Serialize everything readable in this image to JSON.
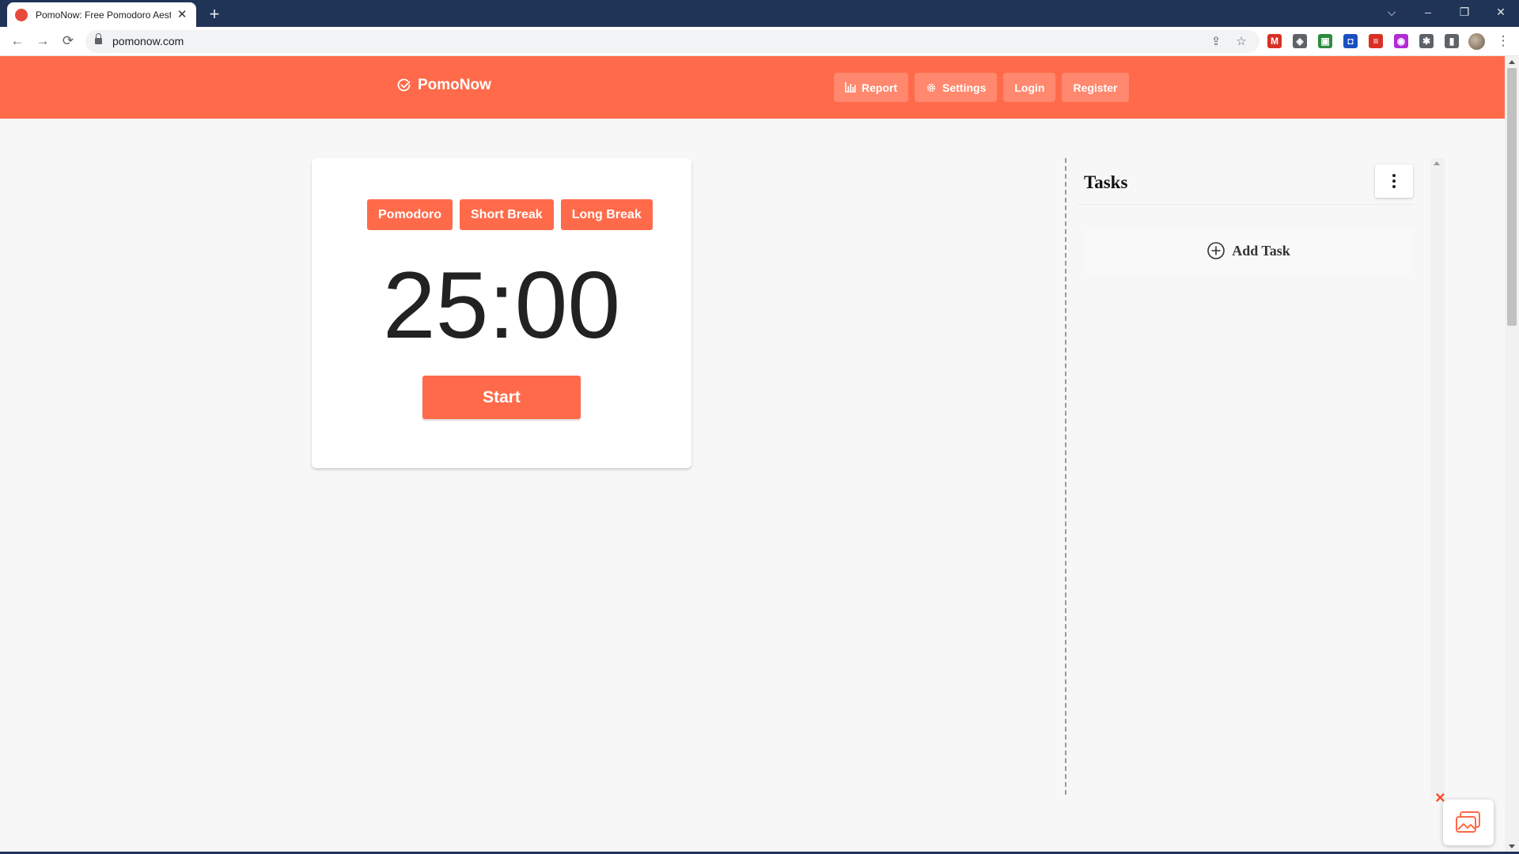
{
  "browser": {
    "tab_title": "PomoNow: Free Pomodoro Aesthetic",
    "tab_close": "✕",
    "new_tab": "+",
    "url": "pomonow.com",
    "window_controls": {
      "list": "⌵",
      "minimize": "–",
      "restore": "❐",
      "close": "✕"
    },
    "nav": {
      "back": "←",
      "forward": "→",
      "reload": "⟳"
    },
    "omnibox_icons": {
      "share": "⇪",
      "bookmark": "☆"
    },
    "extensions": [
      {
        "icon": "gmail-icon",
        "label": "M",
        "color": "#d93025"
      },
      {
        "icon": "diamond-icon",
        "label": "◈",
        "color": "#5f6368"
      },
      {
        "icon": "green-square-icon",
        "label": "▣",
        "color": "#2e8b3e"
      },
      {
        "icon": "blue-shield-icon",
        "label": "◘",
        "color": "#1a4fc0"
      },
      {
        "icon": "red-stack-icon",
        "label": "≡",
        "color": "#d93025"
      },
      {
        "icon": "purple-circle-icon",
        "label": "◉",
        "color": "#b12bd6"
      },
      {
        "icon": "puzzle-icon",
        "label": "✱",
        "color": "#5f6368"
      },
      {
        "icon": "sidepanel-icon",
        "label": "▮",
        "color": "#5f6368"
      }
    ],
    "menu": "⋮"
  },
  "header": {
    "brand": "PomoNow",
    "nav": [
      {
        "label": "Report",
        "icon": "chart-icon"
      },
      {
        "label": "Settings",
        "icon": "gear-icon"
      },
      {
        "label": "Login"
      },
      {
        "label": "Register"
      }
    ],
    "accent": "#ff6b4a"
  },
  "timer": {
    "modes": [
      "Pomodoro",
      "Short Break",
      "Long Break"
    ],
    "time": "25:00",
    "start_label": "Start"
  },
  "tasks": {
    "title": "Tasks",
    "add_label": "Add Task"
  }
}
